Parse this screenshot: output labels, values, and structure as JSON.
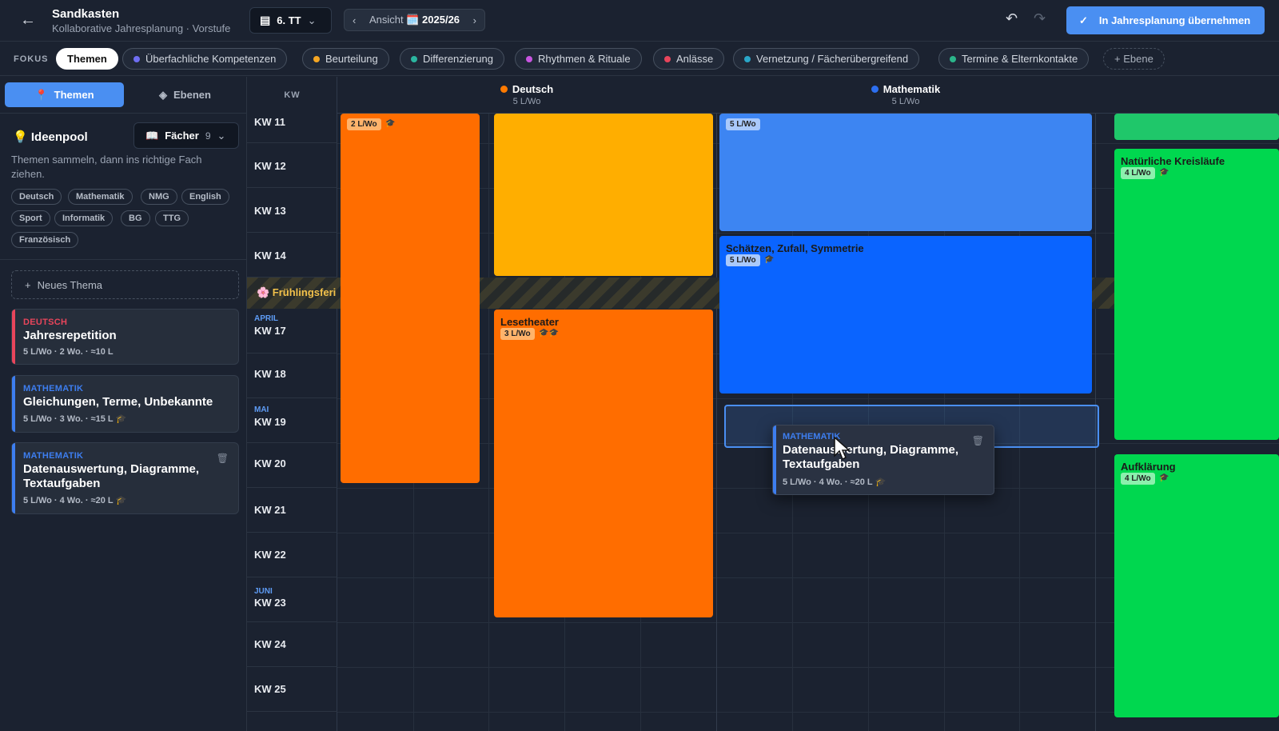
{
  "topbar": {
    "back_icon": "arrow-left-icon",
    "title": "Sandkasten",
    "subtitle": "Kollaborative Jahresplanung · Vorstufe",
    "class_select": "6. TT",
    "year_view_label": "Ansicht",
    "year_view_value": "🗓️ 2025/26",
    "apply_label": "In Jahresplanung übernehmen"
  },
  "focus": {
    "label": "FOKUS",
    "chips": [
      {
        "label": "Themen",
        "color": "",
        "active": true
      },
      {
        "label": "Überfachliche Kompetenzen",
        "color": "#6f6ef2"
      },
      {
        "label": "Beurteilung",
        "color": "#f5a623"
      },
      {
        "label": "Differenzierung",
        "color": "#2bb5a0"
      },
      {
        "label": "Rhythmen & Rituale",
        "color": "#c855e0"
      },
      {
        "label": "Anlässe",
        "color": "#e8455b"
      },
      {
        "label": "Vernetzung / Fächerübergreifend",
        "color": "#2aa6c8"
      },
      {
        "label": "Termine & Elternkontakte",
        "color": "#2bb58a"
      },
      {
        "label": "+ Ebene",
        "color": ""
      }
    ]
  },
  "sidebar": {
    "tab_themes": "Themen",
    "tab_layers": "Ebenen",
    "pool_title": "Ideenpool",
    "subjects_button": "Fächer",
    "subjects_count": "9",
    "pool_description": "Themen sammeln, dann ins richtige Fach ziehen.",
    "tags": [
      "Deutsch",
      "Mathematik",
      "NMG",
      "English",
      "Sport",
      "Informatik",
      "BG",
      "TTG",
      "Französisch"
    ],
    "new_topic": "Neues Thema",
    "cards": [
      {
        "subject": "DEUTSCH",
        "name": "Jahresrepetition",
        "meta": "5 L/Wo · 2 Wo. · ≈10 L",
        "color": "#e8455b",
        "has_cap": false
      },
      {
        "subject": "MATHEMATIK",
        "name": "Gleichungen, Terme, Unbekannte",
        "meta": "5 L/Wo · 3 Wo. · ≈15 L",
        "color": "#3d7ef0",
        "has_cap": true
      },
      {
        "subject": "MATHEMATIK",
        "name": "Datenauswertung, Diagramme, Textaufgaben",
        "meta": "5 L/Wo · 4 Wo. · ≈20 L",
        "color": "#3d7ef0",
        "has_cap": true
      }
    ]
  },
  "grid": {
    "kw_header": "KW",
    "columns": [
      {
        "name": "Deutsch",
        "sub": "5 L/Wo",
        "color": "#ff7a00"
      },
      {
        "name": "Mathematik",
        "sub": "5 L/Wo",
        "color": "#2d6ff0"
      }
    ],
    "weeks": [
      {
        "month": "",
        "label": "KW 11"
      },
      {
        "month": "",
        "label": "KW 12"
      },
      {
        "month": "",
        "label": "KW 13"
      },
      {
        "month": "",
        "label": "KW 14"
      },
      {
        "month": "",
        "label": ""
      },
      {
        "month": "APRIL",
        "label": "KW 17"
      },
      {
        "month": "",
        "label": "KW 18"
      },
      {
        "month": "MAI",
        "label": "KW 19"
      },
      {
        "month": "",
        "label": "KW 20"
      },
      {
        "month": "",
        "label": "KW 21"
      },
      {
        "month": "",
        "label": "KW 22"
      },
      {
        "month": "JUNI",
        "label": "KW 23"
      },
      {
        "month": "",
        "label": "KW 24"
      },
      {
        "month": "",
        "label": "KW 25"
      }
    ],
    "holiday_label": "🌸 Frühlingsferi",
    "blocks": {
      "de_left": {
        "pill": "2 L/Wo"
      },
      "de_lesetheater": {
        "title": "Lesetheater",
        "pill": "3 L/Wo"
      },
      "ma_top": {
        "pill": "5 L/Wo"
      },
      "ma_schaetzen": {
        "title": "Schätzen, Zufall, Symmetrie",
        "pill": "5 L/Wo"
      },
      "nmg_kreis": {
        "title": "Natürliche Kreisläufe",
        "pill": "4 L/Wo"
      },
      "nmg_aufklaerung": {
        "title": "Aufklärung",
        "pill": "4 L/Wo"
      }
    },
    "drag_card": {
      "subject": "MATHEMATIK",
      "name": "Datenauswertung, Diagramme, Textaufgaben",
      "meta": "5 L/Wo · 4 Wo. · ≈20 L"
    }
  }
}
